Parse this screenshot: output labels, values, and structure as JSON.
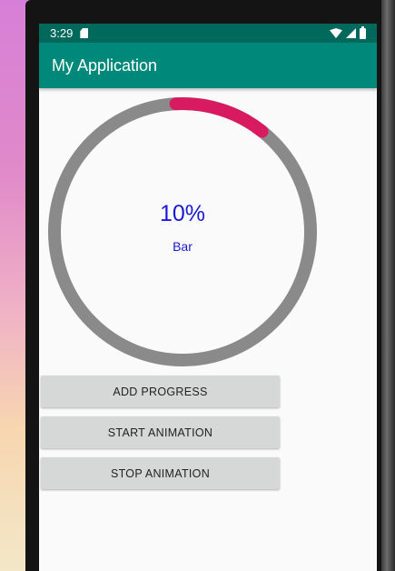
{
  "status_bar": {
    "time": "3:29"
  },
  "app_bar": {
    "title": "My Application"
  },
  "progress": {
    "percent_text": "10%",
    "label": "Bar",
    "value": 0.1,
    "track_color": "#8a8a8a",
    "fill_color": "#d81b60",
    "text_color": "#1a1ad6"
  },
  "buttons": {
    "add_progress": "ADD PROGRESS",
    "start_animation": "START ANIMATION",
    "stop_animation": "STOP ANIMATION"
  },
  "colors": {
    "status_bar": "#00695c",
    "app_bar": "#00897b"
  }
}
